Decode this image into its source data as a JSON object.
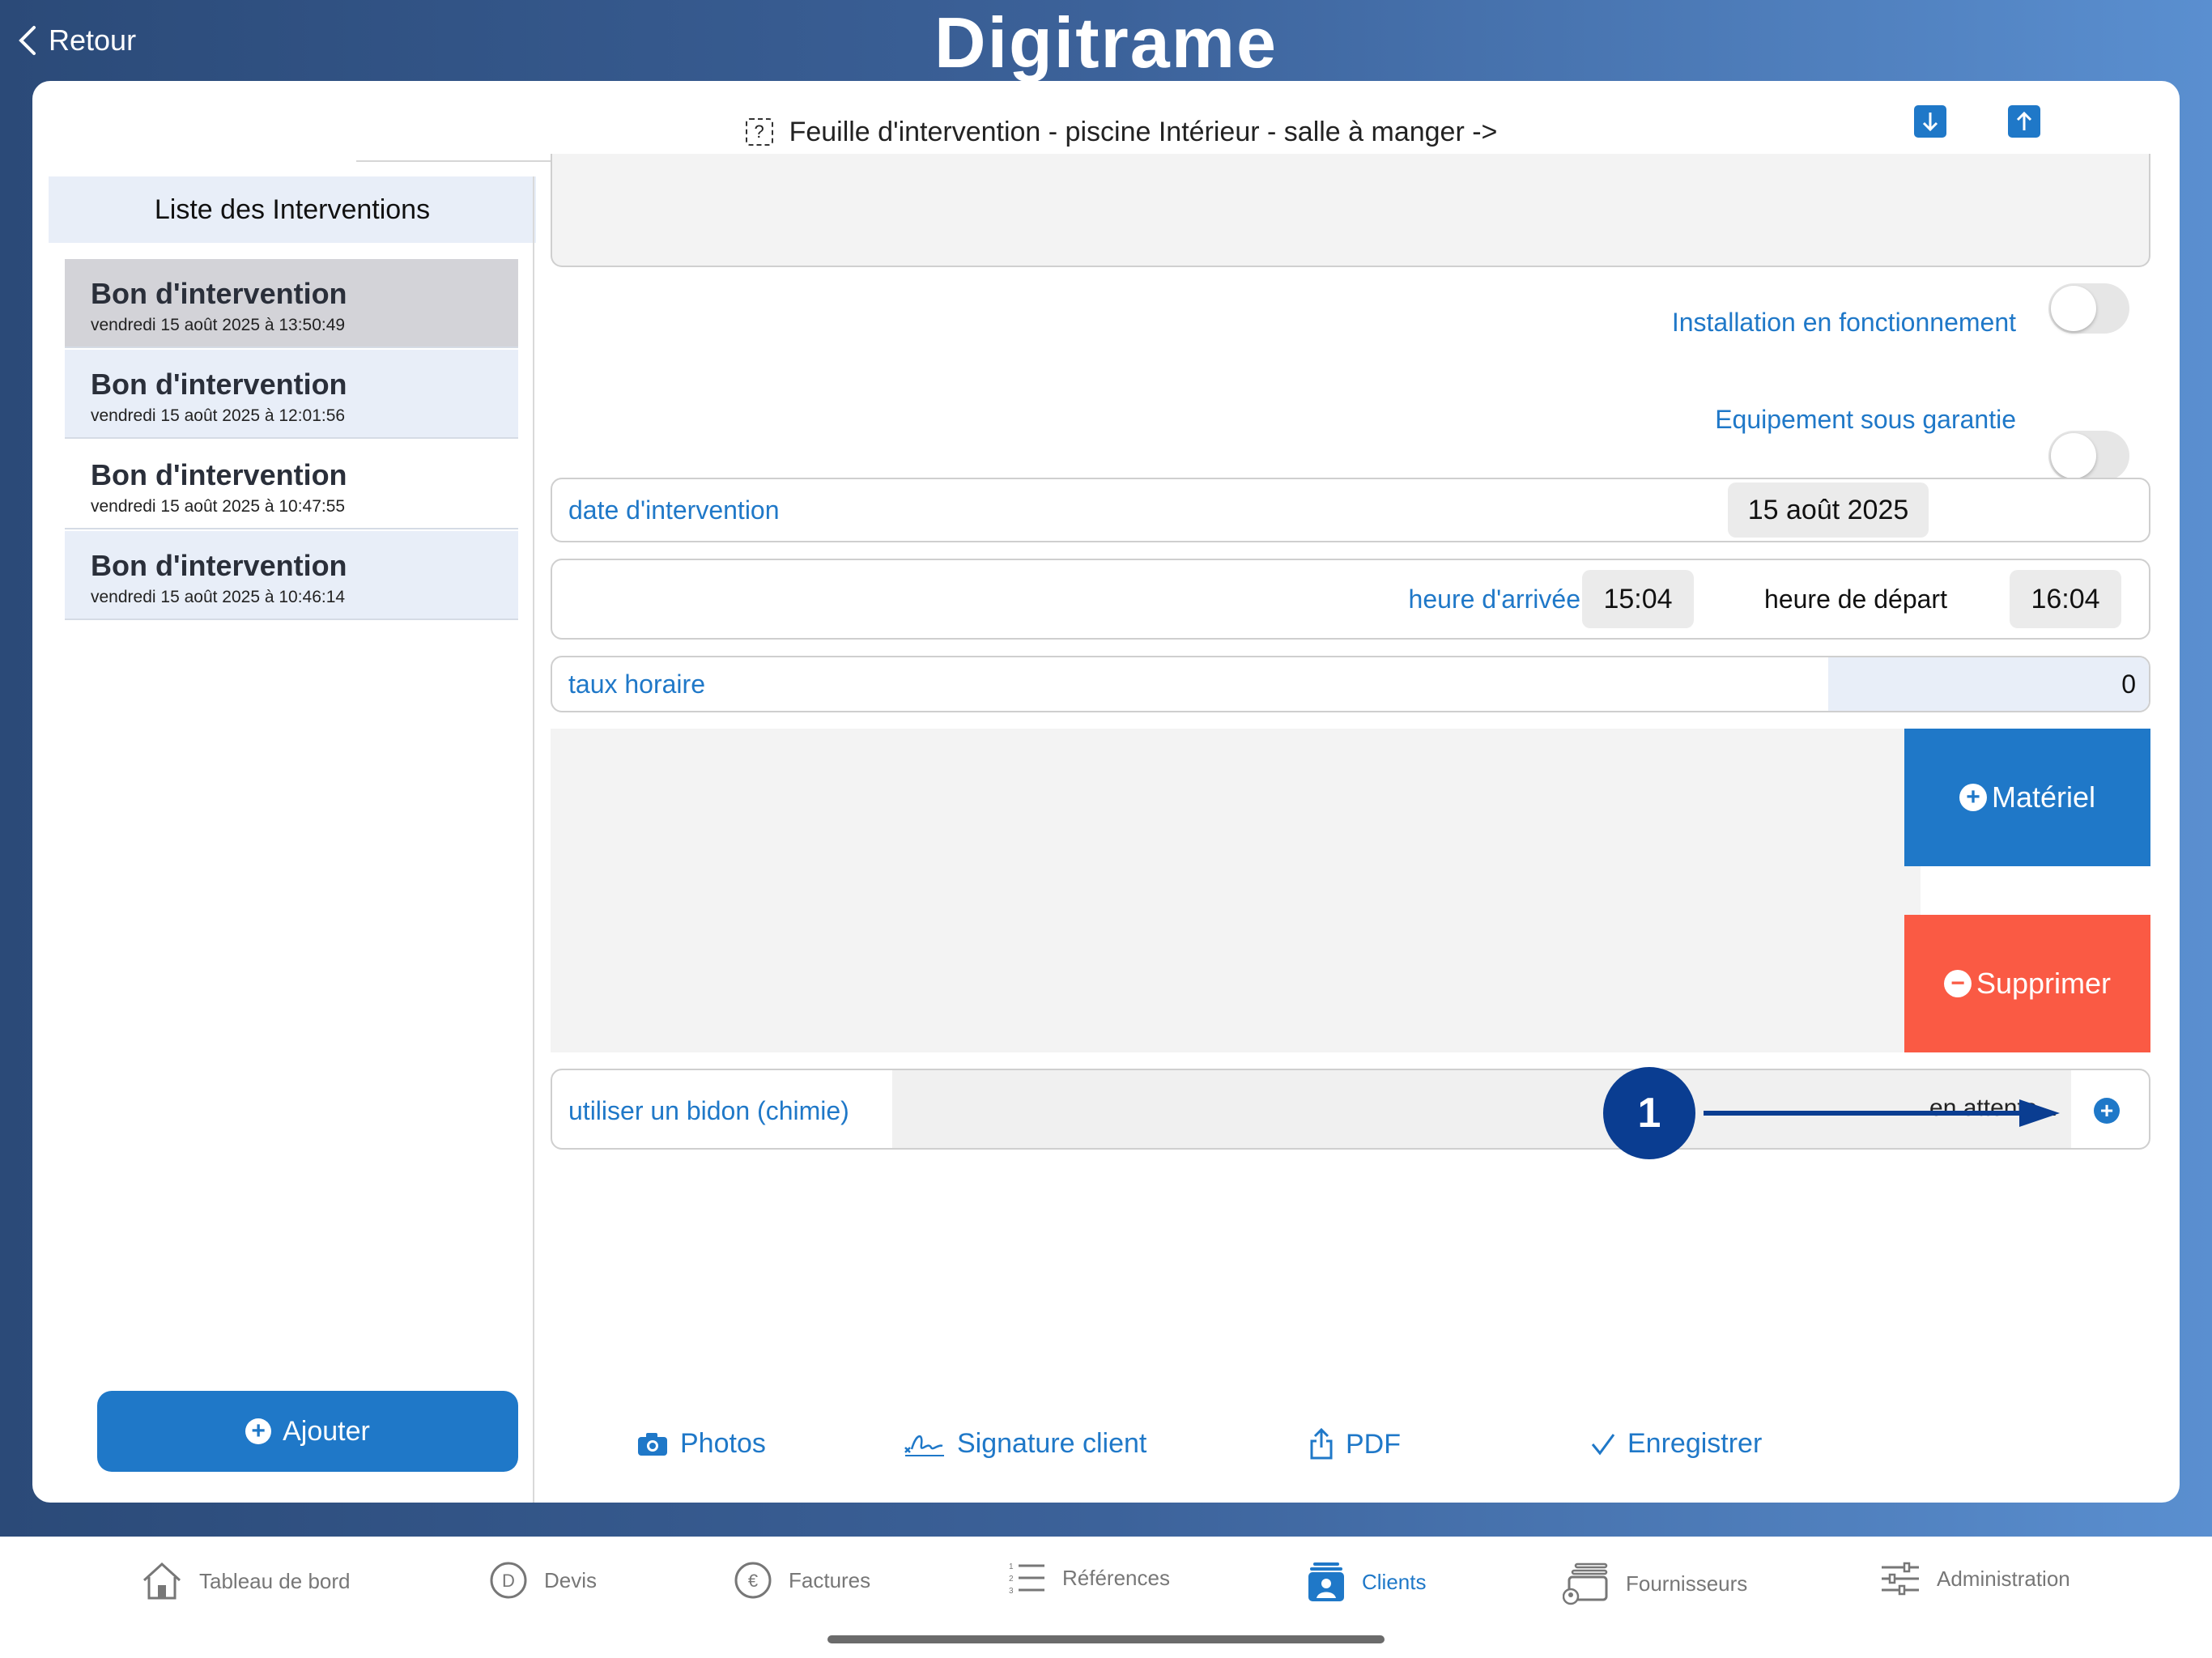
{
  "nav": {
    "back_label": "Retour",
    "app_logo": "Digitrame"
  },
  "header": {
    "title": "Feuille d'intervention - piscine Intérieur - salle à manger ->",
    "title_icon": "question-square-icon"
  },
  "sidebar": {
    "title": "Liste des Interventions",
    "items": [
      {
        "title": "Bon d'intervention",
        "date": "vendredi 15 août 2025 à 13:50:49",
        "state": "selected"
      },
      {
        "title": "Bon d'intervention",
        "date": "vendredi 15 août 2025 à 12:01:56",
        "state": "tinted"
      },
      {
        "title": "Bon d'intervention",
        "date": "vendredi 15 août 2025 à 10:47:55",
        "state": "plain"
      },
      {
        "title": "Bon d'intervention",
        "date": "vendredi 15 août 2025 à 10:46:14",
        "state": "tinted"
      }
    ],
    "add_label": "Ajouter"
  },
  "form": {
    "toggle_installation": {
      "label": "Installation en fonctionnement",
      "on": false
    },
    "toggle_garantie": {
      "label": "Equipement sous garantie",
      "on": false
    },
    "date": {
      "label": "date d'intervention",
      "value": "15 août 2025"
    },
    "arrival": {
      "label": "heure d'arrivée",
      "value": "15:04"
    },
    "departure": {
      "label": "heure de départ",
      "value": "16:04"
    },
    "rate": {
      "label": "taux horaire",
      "value": "0"
    },
    "materiel_label": "Matériel",
    "supprimer_label": "Supprimer",
    "bidon": {
      "label": "utiliser un bidon (chimie)",
      "status": "...en attente..."
    }
  },
  "annotation": {
    "marker": "1"
  },
  "actions": {
    "photos": "Photos",
    "signature": "Signature client",
    "pdf": "PDF",
    "save": "Enregistrer"
  },
  "tabs": [
    {
      "label": "Tableau de bord",
      "icon": "house-icon"
    },
    {
      "label": "Devis",
      "icon": "d-circle-icon"
    },
    {
      "label": "Factures",
      "icon": "euro-circle-icon"
    },
    {
      "label": "Références",
      "icon": "numbered-list-icon"
    },
    {
      "label": "Clients",
      "icon": "person-card-icon",
      "active": true
    },
    {
      "label": "Fournisseurs",
      "icon": "supplier-icon"
    },
    {
      "label": "Administration",
      "icon": "sliders-icon"
    }
  ],
  "colors": {
    "accent": "#1f78c8",
    "danger": "#fa5a44",
    "selected_row": "#d3d3d8",
    "tinted_row": "#e8eef8",
    "annotation": "#0a3d91"
  }
}
